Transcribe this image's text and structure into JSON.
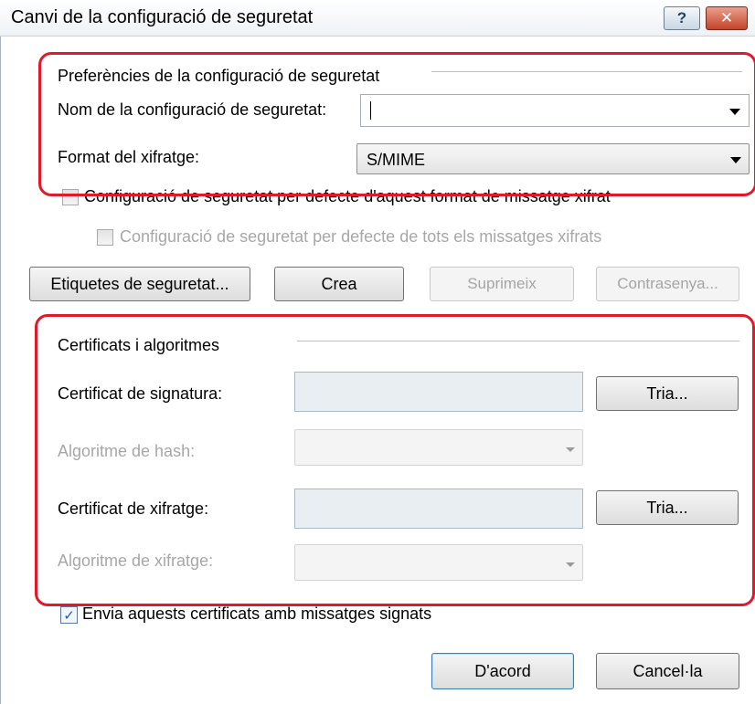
{
  "dialog": {
    "title": "Canvi de la configuració de seguretat",
    "help_glyph": "?",
    "close_glyph": "✕"
  },
  "prefs": {
    "group_label": "Preferències de la configuració de seguretat",
    "name_label": "Nom de la configuració de seguretat:",
    "name_value": "",
    "format_label": "Format del xifratge:",
    "format_value": "S/MIME",
    "default_for_format_label": "Configuració de seguretat per defecte d'aquest format de missatge xifrat",
    "default_for_format_checked": false,
    "default_for_all_label": "Configuració de seguretat per defecte de tots els missatges xifrats",
    "default_for_all_checked": false
  },
  "actions": {
    "labels_button": "Etiquetes de seguretat...",
    "create_button": "Crea",
    "delete_button": "Suprimeix",
    "password_button": "Contrasenya..."
  },
  "certs": {
    "group_label": "Certificats i algoritmes",
    "signing_label": "Certificat de signatura:",
    "signing_value": "",
    "choose_button": "Tria...",
    "hash_label": "Algoritme de hash:",
    "hash_value": "",
    "encryption_label": "Certificat de xifratge:",
    "encryption_value": "",
    "encryption_alg_label": "Algoritme de xifratge:",
    "encryption_alg_value": "",
    "send_label": "Envia aquests certificats amb missatges signats",
    "send_checked": true
  },
  "footer": {
    "ok_button": "D'acord",
    "cancel_button": "Cancel·la"
  },
  "colors": {
    "highlight_outline": "#e01a2b",
    "disabled_text": "#a7a7a7"
  }
}
